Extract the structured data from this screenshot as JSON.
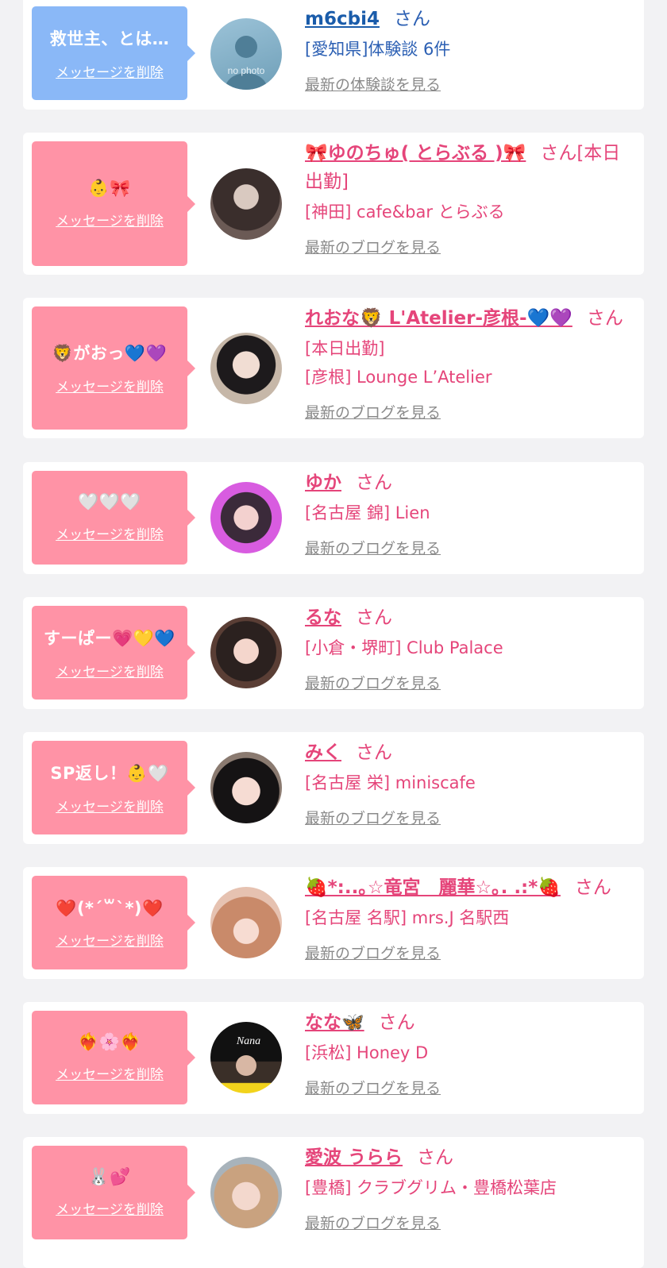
{
  "delete_label": "メッセージを削除",
  "san": "さん",
  "colors": {
    "pink": "#ff93a6",
    "blue": "#8ab8f7",
    "name_pink": "#e5457a",
    "name_blue": "#1a5caa"
  },
  "cards": [
    {
      "bubble": "救世主、とは…",
      "name": "m6cbi4",
      "line1": "[愛知県]体験談 6件",
      "line2": "",
      "more": "最新の体験談を見る",
      "avatar_text": "no photo"
    },
    {
      "bubble": "👶🎀",
      "name": "🎀ゆのちゅ( とらぶる )🎀",
      "line1": "[本日出勤]",
      "line2": "[神田] cafe&bar とらぶる",
      "more": "最新のブログを見る"
    },
    {
      "bubble": "🦁がおっ💙💜",
      "name": "れおな🦁 L'Atelier-彦根-💙💜",
      "line1": "[本日出勤]",
      "line2": "[彦根] Lounge L’Atelier",
      "more": "最新のブログを見る"
    },
    {
      "bubble": "🤍🤍🤍",
      "name": "ゆか",
      "line1": "[名古屋 錦] Lien",
      "line2": "",
      "more": "最新のブログを見る"
    },
    {
      "bubble": "すーぱー💗💛💙",
      "name": "るな",
      "line1": "[小倉・堺町] Club Palace",
      "line2": "",
      "more": "最新のブログを見る"
    },
    {
      "bubble": "SP返し！👶🤍",
      "name": "みく",
      "line1": "[名古屋 栄] miniscafe",
      "line2": "",
      "more": "最新のブログを見る"
    },
    {
      "bubble": "❤️(*´꒳`*)❤️",
      "name": "🍓*:..｡☆竜宮　麗華☆｡. .:*🍓",
      "line1": "[名古屋 名駅] mrs.J 名駅西",
      "line2": "",
      "more": "最新のブログを見る"
    },
    {
      "bubble": "❤️‍🔥🌸❤️‍🔥",
      "name": "なな🦋",
      "line1": "[浜松] Honey D",
      "line2": "",
      "more": "最新のブログを見る",
      "avatar_text": "Nana"
    },
    {
      "bubble": "🐰💕",
      "name": "愛波 うらら",
      "line1": "[豊橋] クラブグリム・豊橋松葉店",
      "line2": "",
      "more": "最新のブログを見る"
    }
  ]
}
